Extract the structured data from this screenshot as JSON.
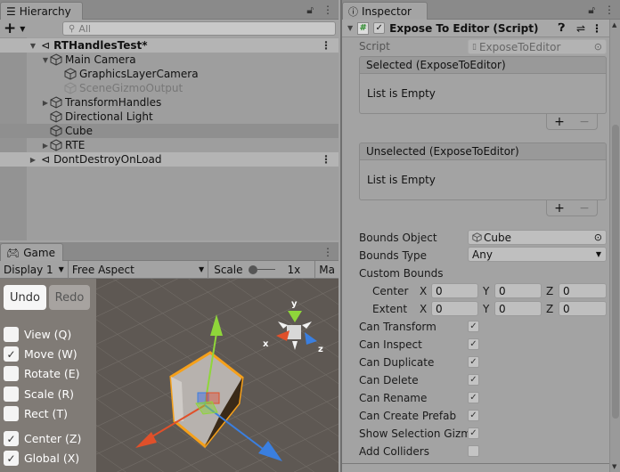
{
  "hierarchy": {
    "tab_label": "Hierarchy",
    "add_label": "+",
    "search_placeholder": "All",
    "items": [
      {
        "label": "RTHandlesTest*",
        "type": "scene",
        "expanded": true
      },
      {
        "label": "Main Camera",
        "expanded": true
      },
      {
        "label": "GraphicsLayerCamera"
      },
      {
        "label": "SceneGizmoOutput",
        "disabled": true
      },
      {
        "label": "TransformHandles",
        "expanded": false
      },
      {
        "label": "Directional Light"
      },
      {
        "label": "Cube",
        "selected": true
      },
      {
        "label": "RTE",
        "expanded": false
      },
      {
        "label": "DontDestroyOnLoad",
        "type": "scene",
        "expanded": false
      }
    ]
  },
  "game": {
    "tab_label": "Game",
    "display": "Display 1",
    "aspect": "Free Aspect",
    "scale_label": "Scale",
    "scale_value": "1x",
    "maximize_label": "Ma",
    "undo_label": "Undo",
    "redo_label": "Redo",
    "tools": [
      {
        "label": "View (Q)",
        "checked": false
      },
      {
        "label": "Move (W)",
        "checked": true
      },
      {
        "label": "Rotate (E)",
        "checked": false
      },
      {
        "label": "Scale (R)",
        "checked": false
      },
      {
        "label": "Rect (T)",
        "checked": false
      },
      {
        "label": "Center (Z)",
        "checked": true
      },
      {
        "label": "Global (X)",
        "checked": true
      }
    ],
    "gizmo_axes": {
      "x": "x",
      "y": "y",
      "z": "z"
    }
  },
  "inspector": {
    "tab_label": "Inspector",
    "component_title": "Expose To Editor (Script)",
    "script_label": "Script",
    "script_value": "ExposeToEditor",
    "selected_header": "Selected (ExposeToEditor)",
    "selected_empty": "List is Empty",
    "unselected_header": "Unselected (ExposeToEditor)",
    "unselected_empty": "List is Empty",
    "plus": "+",
    "minus": "−",
    "bounds_object_label": "Bounds Object",
    "bounds_object_value": "Cube",
    "bounds_type_label": "Bounds Type",
    "bounds_type_value": "Any",
    "custom_bounds_label": "Custom Bounds",
    "center_label": "Center",
    "extent_label": "Extent",
    "center": {
      "x": "0",
      "y": "0",
      "z": "0"
    },
    "extent": {
      "x": "0",
      "y": "0",
      "z": "0"
    },
    "axis_x": "X",
    "axis_y": "Y",
    "axis_z": "Z",
    "toggles": [
      {
        "label": "Can Transform",
        "checked": true
      },
      {
        "label": "Can Inspect",
        "checked": true
      },
      {
        "label": "Can Duplicate",
        "checked": true
      },
      {
        "label": "Can Delete",
        "checked": true
      },
      {
        "label": "Can Rename",
        "checked": true
      },
      {
        "label": "Can Create Prefab",
        "checked": true
      },
      {
        "label": "Show Selection Gizm",
        "checked": true
      },
      {
        "label": "Add Colliders",
        "checked": false
      }
    ]
  },
  "colors": {
    "x_axis": "#e0502a",
    "y_axis": "#8fd63a",
    "z_axis": "#3a7fe0",
    "selection": "#f5a01a"
  }
}
